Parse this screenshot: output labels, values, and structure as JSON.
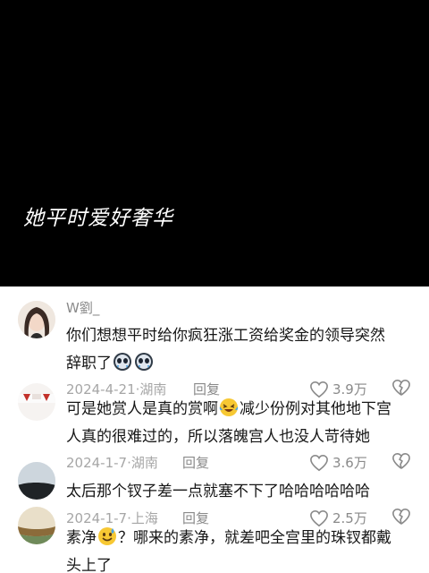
{
  "video": {
    "subtitle": "她平时爱好奢华"
  },
  "comments": [
    {
      "username": "W劉_",
      "text_parts": [
        "你们想想平时给你疯狂涨工资给奖金的领导突然",
        "辞职了"
      ],
      "emojis": [
        "crying-face-emoji",
        "crying-face-emoji"
      ],
      "date": "2024-4-21",
      "location": "湖南",
      "reply_label": "回复",
      "likes": "3.9万"
    },
    {
      "text_parts": [
        "可是她赏人是真的赏啊",
        "减少份例对其他地下宫",
        "人真的很难过的，所以落魄宫人也没人苛待她"
      ],
      "emojis": [
        "laughing-crying-emoji"
      ],
      "date": "2024-1-7",
      "location": "湖南",
      "reply_label": "回复",
      "likes": "3.6万"
    },
    {
      "text_parts": [
        "太后那个钗子差一点就塞不下了哈哈哈哈哈哈"
      ],
      "date": "2024-1-7",
      "location": "上海",
      "reply_label": "回复",
      "likes": "2.5万"
    },
    {
      "text_parts": [
        "素净",
        "？哪来的素净，就差吧全宫里的珠钗都戴",
        "头上了"
      ],
      "emojis": [
        "sweat-smile-emoji"
      ]
    }
  ],
  "separator": "·",
  "colors": {
    "background": "#ffffff",
    "video_bg": "#000000",
    "text": "#161616",
    "meta": "#a6a6a6"
  }
}
